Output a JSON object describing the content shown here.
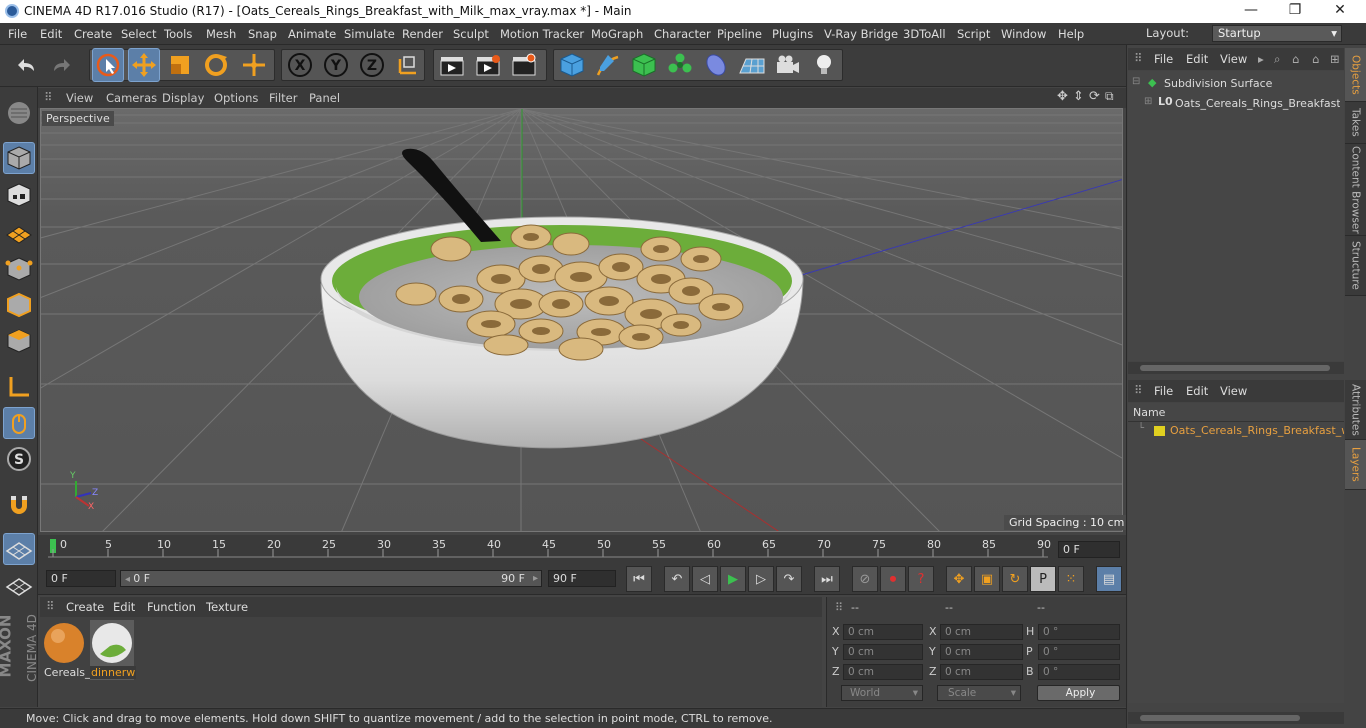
{
  "titlebar": {
    "title": "CINEMA 4D R17.016 Studio (R17) - [Oats_Cereals_Rings_Breakfast_with_Milk_max_vray.max *] - Main",
    "minimize": "—",
    "restore": "❐",
    "close": "✕"
  },
  "menu": [
    "File",
    "Edit",
    "Create",
    "Select",
    "Tools",
    "Mesh",
    "Snap",
    "Animate",
    "Simulate",
    "Render",
    "Sculpt",
    "Motion Tracker",
    "MoGraph",
    "Character",
    "Pipeline",
    "Plugins",
    "V-Ray Bridge",
    "3DToAll",
    "Script",
    "Window",
    "Help"
  ],
  "layout": {
    "label": "Layout:",
    "value": "Startup"
  },
  "viewport": {
    "menu": [
      "View",
      "Cameras",
      "Display",
      "Options",
      "Filter",
      "Panel"
    ],
    "camera": "Perspective",
    "grid_spacing": "Grid Spacing : 10 cm",
    "axis_labels": {
      "y": "Y",
      "z": "Z",
      "x": "X"
    }
  },
  "timeline": {
    "ticks": [
      "0",
      "5",
      "10",
      "15",
      "20",
      "25",
      "30",
      "35",
      "40",
      "45",
      "50",
      "55",
      "60",
      "65",
      "70",
      "75",
      "80",
      "85",
      "90"
    ],
    "current_frame": "0 F",
    "start_field": "0 F",
    "range_start": "0 F",
    "range_end": "90 F",
    "end_field": "90 F"
  },
  "material_manager": {
    "menu": [
      "Create",
      "Edit",
      "Function",
      "Texture"
    ],
    "materials": [
      {
        "name": "Cereals_",
        "color": "#d9822b"
      },
      {
        "name": "dinnerw",
        "color": "#e8e8e8"
      }
    ]
  },
  "coordinates": {
    "headers": [
      "--",
      "--",
      "--"
    ],
    "rows": [
      {
        "l1": "X",
        "v1": "0 cm",
        "l2": "X",
        "v2": "0 cm",
        "l3": "H",
        "v3": "0 °"
      },
      {
        "l1": "Y",
        "v1": "0 cm",
        "l2": "Y",
        "v2": "0 cm",
        "l3": "P",
        "v3": "0 °"
      },
      {
        "l1": "Z",
        "v1": "0 cm",
        "l2": "Z",
        "v2": "0 cm",
        "l3": "B",
        "v3": "0 °"
      }
    ],
    "mode1": "World",
    "mode2": "Scale",
    "apply": "Apply"
  },
  "status": "Move: Click and drag to move elements. Hold down SHIFT to quantize movement / add to the selection in point mode, CTRL to remove.",
  "objects_panel": {
    "menu": [
      "File",
      "Edit",
      "View"
    ],
    "items": [
      {
        "name": "Subdivision Surface"
      },
      {
        "name": "Oats_Cereals_Rings_Breakfast_w"
      }
    ]
  },
  "attributes_panel": {
    "menu": [
      "File",
      "Edit",
      "View"
    ],
    "column": "Name",
    "layer": "Oats_Cereals_Rings_Breakfast_wit"
  },
  "side_tabs": [
    "Objects",
    "Takes",
    "Content Browser",
    "Structure",
    "Attributes",
    "Layers"
  ],
  "brand": {
    "maxon": "MAXON",
    "product": "CINEMA 4D"
  },
  "colors": {
    "accent": "#e8a040",
    "selected_tool": "#5c7fa8",
    "layer_color": "#e0d020"
  }
}
